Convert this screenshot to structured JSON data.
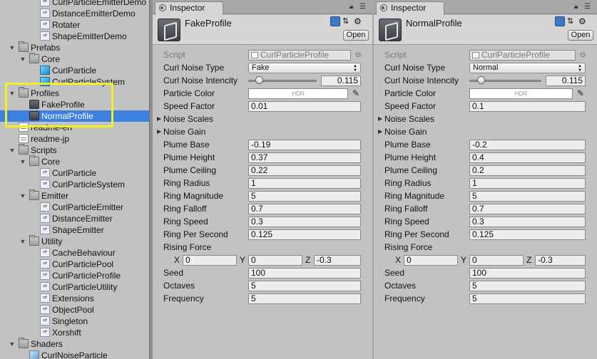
{
  "project_tree": [
    {
      "label": "CurlParticleEmitterDemo",
      "indent": 2,
      "icon": "script-file-icon"
    },
    {
      "label": "DistanceEmitterDemo",
      "indent": 2,
      "icon": "script-file-icon"
    },
    {
      "label": "Rotater",
      "indent": 2,
      "icon": "script-file-icon"
    },
    {
      "label": "ShapeEmitterDemo",
      "indent": 2,
      "icon": "script-file-icon"
    },
    {
      "label": "Prefabs",
      "indent": 0,
      "icon": "folder-icon",
      "expanded": true
    },
    {
      "label": "Core",
      "indent": 1,
      "icon": "folder-icon",
      "expanded": true
    },
    {
      "label": "CurlParticle",
      "indent": 2,
      "icon": "prefab-cube-icon"
    },
    {
      "label": "CurlParticleSystem",
      "indent": 2,
      "icon": "prefab-cube-icon"
    },
    {
      "label": "Profiles",
      "indent": 0,
      "icon": "folder-icon",
      "expanded": true
    },
    {
      "label": "FakeProfile",
      "indent": 1,
      "icon": "profile-asset-icon"
    },
    {
      "label": "NormalProfile",
      "indent": 1,
      "icon": "profile-asset-icon",
      "selected": true
    },
    {
      "label": "readme-en",
      "indent": 0,
      "icon": "text-file-icon"
    },
    {
      "label": "readme-jp",
      "indent": 0,
      "icon": "text-file-icon"
    },
    {
      "label": "Scripts",
      "indent": 0,
      "icon": "folder-icon",
      "expanded": true
    },
    {
      "label": "Core",
      "indent": 1,
      "icon": "folder-icon",
      "expanded": true
    },
    {
      "label": "CurlParticle",
      "indent": 2,
      "icon": "script-file-icon"
    },
    {
      "label": "CurlParticleSystem",
      "indent": 2,
      "icon": "script-file-icon"
    },
    {
      "label": "Emitter",
      "indent": 1,
      "icon": "folder-icon",
      "expanded": true
    },
    {
      "label": "CurlParticleEmitter",
      "indent": 2,
      "icon": "script-file-icon"
    },
    {
      "label": "DistanceEmitter",
      "indent": 2,
      "icon": "script-file-icon"
    },
    {
      "label": "ShapeEmitter",
      "indent": 2,
      "icon": "script-file-icon"
    },
    {
      "label": "Utility",
      "indent": 1,
      "icon": "folder-icon",
      "expanded": true
    },
    {
      "label": "CacheBehaviour",
      "indent": 2,
      "icon": "script-file-icon"
    },
    {
      "label": "CurlParticlePool",
      "indent": 2,
      "icon": "script-file-icon"
    },
    {
      "label": "CurlParticleProfile",
      "indent": 2,
      "icon": "script-file-icon"
    },
    {
      "label": "CurlParticleUtility",
      "indent": 2,
      "icon": "script-file-icon"
    },
    {
      "label": "Extensions",
      "indent": 2,
      "icon": "script-file-icon"
    },
    {
      "label": "ObjectPool",
      "indent": 2,
      "icon": "script-file-icon"
    },
    {
      "label": "Singleton",
      "indent": 2,
      "icon": "script-file-icon"
    },
    {
      "label": "Xorshift",
      "indent": 2,
      "icon": "script-file-icon"
    },
    {
      "label": "Shaders",
      "indent": 0,
      "icon": "folder-icon",
      "expanded": true
    },
    {
      "label": "CurlNoiseParticle",
      "indent": 1,
      "icon": "shader-file-icon"
    }
  ],
  "script_file_icon_text": "c#",
  "labels": {
    "tab": "Inspector",
    "open": "Open",
    "script": "Script",
    "noise_type": "Curl Noise Type",
    "intencity": "Curl Noise Intencity",
    "particle_color": "Particle Color",
    "hdr": "HDR",
    "speed_factor": "Speed Factor",
    "noise_scales": "Noise Scales",
    "noise_gain": "Noise Gain",
    "plume_base": "Plume Base",
    "plume_height": "Plume Height",
    "plume_ceiling": "Plume Ceiling",
    "ring_radius": "Ring Radius",
    "ring_magnitude": "Ring Magnitude",
    "ring_falloff": "Ring Falloff",
    "ring_speed": "Ring Speed",
    "ring_per_second": "Ring Per Second",
    "rising_force": "Rising Force",
    "x": "X",
    "y": "Y",
    "z": "Z",
    "seed": "Seed",
    "octaves": "Octaves",
    "frequency": "Frequency"
  },
  "inspectors": [
    {
      "profile_name": "FakeProfile",
      "script_value": "CurlParticleProfile",
      "noise_type": "Fake",
      "intencity": "0.115",
      "intencity_level": 0.12,
      "speed_factor": "0.01",
      "plume_base": "-0.19",
      "plume_height": "0.37",
      "plume_ceiling": "0.22",
      "ring_radius": "1",
      "ring_magnitude": "5",
      "ring_falloff": "0.7",
      "ring_speed": "0.3",
      "ring_per_second": "0.125",
      "rising_x": "0",
      "rising_y": "0",
      "rising_z": "-0.3",
      "seed": "100",
      "octaves": "5",
      "frequency": "5"
    },
    {
      "profile_name": "NormalProfile",
      "script_value": "CurlParticleProfile",
      "noise_type": "Normal",
      "intencity": "0.115",
      "intencity_level": 0.12,
      "speed_factor": "0.1",
      "plume_base": "-0.2",
      "plume_height": "0.4",
      "plume_ceiling": "0.2",
      "ring_radius": "1",
      "ring_magnitude": "5",
      "ring_falloff": "0.7",
      "ring_speed": "0.3",
      "ring_per_second": "0.125",
      "rising_x": "0",
      "rising_y": "0",
      "rising_z": "-0.3",
      "seed": "100",
      "octaves": "5",
      "frequency": "5"
    }
  ],
  "colors": {
    "selection": "#3d80df",
    "highlight_box": "#eef227"
  }
}
